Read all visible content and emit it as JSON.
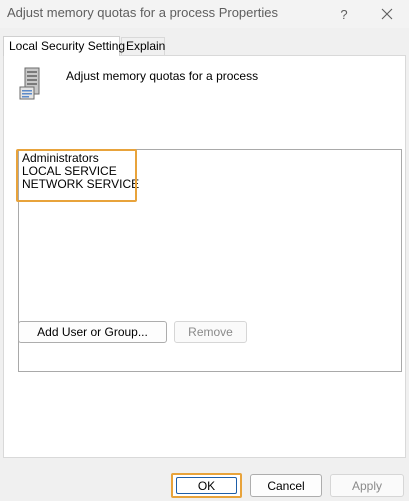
{
  "window": {
    "title": "Adjust memory quotas for a process Properties",
    "help_label": "?"
  },
  "tabs": [
    {
      "label": "Local Security Setting",
      "active": true
    },
    {
      "label": "Explain",
      "active": false
    }
  ],
  "policy": {
    "icon": "server-policy-icon",
    "name": "Adjust memory quotas for a process"
  },
  "principals": [
    "Administrators",
    "LOCAL SERVICE",
    "NETWORK SERVICE"
  ],
  "buttons": {
    "add": "Add User or Group...",
    "remove": "Remove",
    "ok": "OK",
    "cancel": "Cancel",
    "apply": "Apply"
  },
  "colors": {
    "highlight": "#e8a33b",
    "focus": "#1e5ea8"
  }
}
